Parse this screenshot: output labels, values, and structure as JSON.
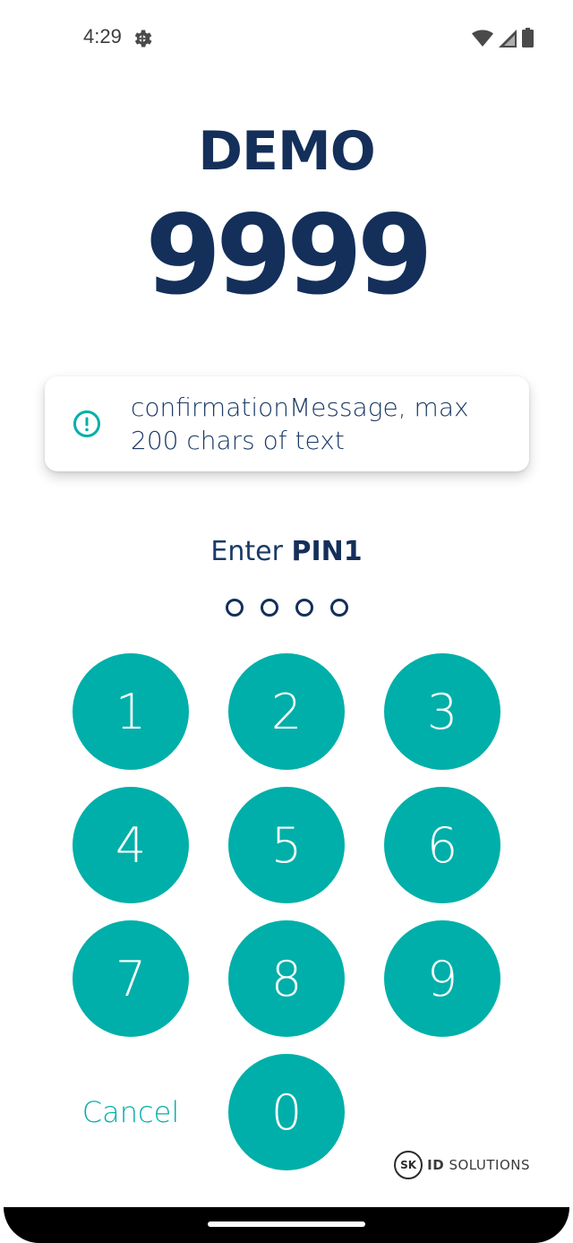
{
  "status_bar": {
    "time": "4:29",
    "icons": [
      "settings-icon",
      "wifi-icon",
      "cellular-signal-icon",
      "battery-icon"
    ]
  },
  "header": {
    "title": "DEMO",
    "code": "9999"
  },
  "confirmation": {
    "message": "confirmationMessage, max 200 chars of text",
    "icon": "info-icon"
  },
  "pin": {
    "prompt_prefix": "Enter",
    "prompt_label": "PIN1",
    "entered_count": 0,
    "dot_count": 4
  },
  "keypad": {
    "keys": [
      "1",
      "2",
      "3",
      "4",
      "5",
      "6",
      "7",
      "8",
      "9",
      "0"
    ],
    "cancel_label": "Cancel"
  },
  "brand": {
    "logo_text": "SK",
    "name_bold": "ID",
    "name_rest": "SOLUTIONS"
  },
  "colors": {
    "accent": "#00afa9",
    "navy": "#142f5a",
    "background": "#ffffff"
  }
}
